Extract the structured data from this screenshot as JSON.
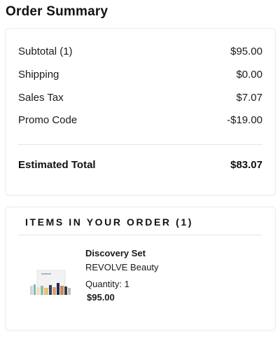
{
  "summary": {
    "title": "Order Summary",
    "lines": [
      {
        "label": "Subtotal (1)",
        "amount": "$95.00"
      },
      {
        "label": "Shipping",
        "amount": "$0.00"
      },
      {
        "label": "Sales Tax",
        "amount": "$7.07"
      },
      {
        "label": "Promo Code",
        "amount": "-$19.00"
      }
    ],
    "total": {
      "label": "Estimated Total",
      "amount": "$83.07"
    }
  },
  "items": {
    "heading": "ITEMS IN YOUR ORDER (1)",
    "list": [
      {
        "name": "Discovery Set",
        "brand": "REVOLVE Beauty",
        "quantity_text": "Quantity: 1",
        "price": "$95.00",
        "image_icon": "product-thumbnail-image"
      }
    ]
  }
}
